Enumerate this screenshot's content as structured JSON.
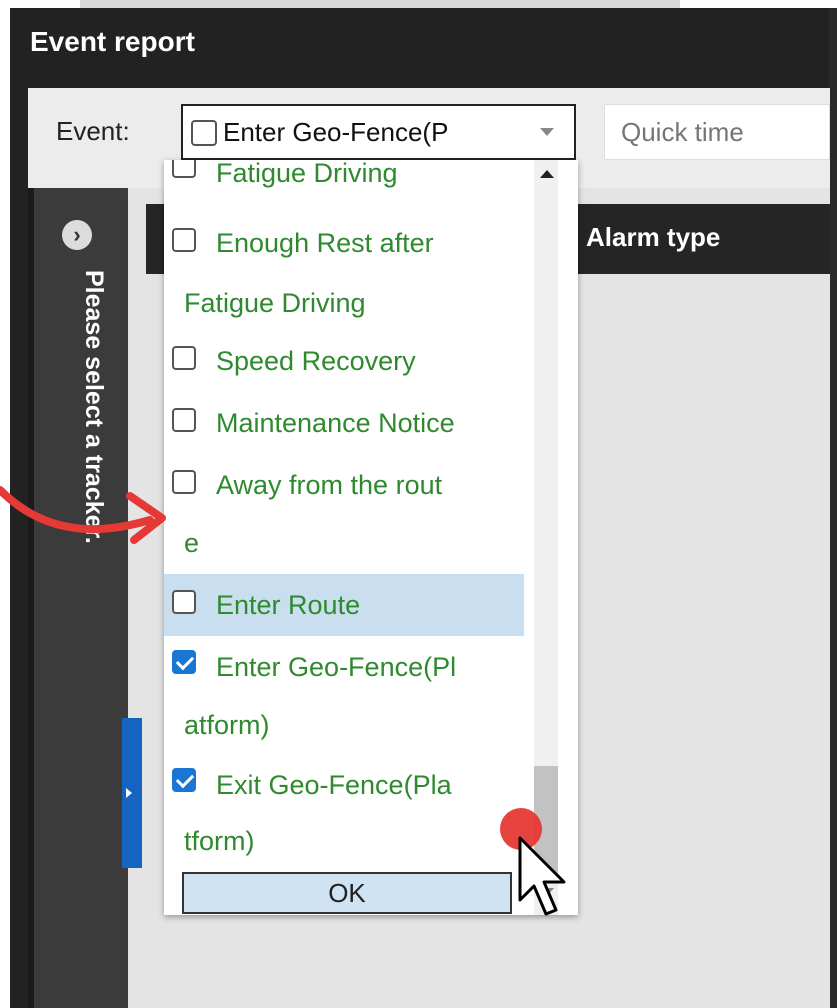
{
  "window": {
    "title": "Event report"
  },
  "filter": {
    "event_label": "Event:",
    "event_value": "Enter Geo-Fence(P",
    "quick_time_placeholder": "Quick time"
  },
  "sidebar": {
    "tracker_prompt": "Please select a tracker."
  },
  "table": {
    "columns": [
      "Alarm type"
    ]
  },
  "dropdown": {
    "options": [
      {
        "lines": [
          "Fatigue Driving"
        ],
        "checked": false,
        "highlighted": false
      },
      {
        "lines": [
          "Enough Rest after",
          "Fatigue Driving"
        ],
        "checked": false,
        "highlighted": false
      },
      {
        "lines": [
          "Speed Recovery"
        ],
        "checked": false,
        "highlighted": false
      },
      {
        "lines": [
          "Maintenance Notice"
        ],
        "checked": false,
        "highlighted": false
      },
      {
        "lines": [
          "Away from the rout",
          "e"
        ],
        "checked": false,
        "highlighted": false
      },
      {
        "lines": [
          "Enter Route"
        ],
        "checked": false,
        "highlighted": true
      },
      {
        "lines": [
          "Enter Geo-Fence(Pl",
          "atform)"
        ],
        "checked": true,
        "highlighted": false
      },
      {
        "lines": [
          "Exit Geo-Fence(Pla",
          "tform)"
        ],
        "checked": true,
        "highlighted": false
      }
    ],
    "ok_label": "OK"
  },
  "colors": {
    "option_text": "#2f8a2f",
    "checkbox_checked": "#1976d2",
    "highlight": "#c9dff0",
    "annotation": "#e53935"
  }
}
